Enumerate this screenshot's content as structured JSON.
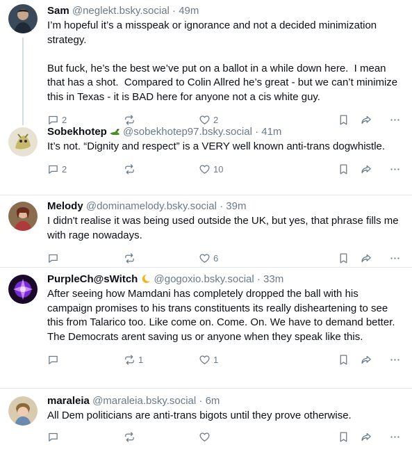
{
  "posts": [
    {
      "name": "Sam",
      "handle": "@neglekt.bsky.social",
      "time": "49m",
      "text": "I’m hopeful it’s a misspeak or ignorance and not a decided minimization strategy.\n\nBut fuck, he’s the best we’ve put on a ballot in a while down here.  I mean that has a shot.  Compared to Colin Allred he’s great - but we can’t minimize this in Texas - it is BAD here for anyone not a cis white guy.",
      "replies": "2",
      "reposts": "",
      "likes": "2"
    },
    {
      "name": "Sobekhotep",
      "handle": "@sobekhotep97.bsky.social",
      "time": "41m",
      "text": "It’s not. “Dignity and respect” is a VERY well known anti-trans dogwhistle.",
      "replies": "2",
      "reposts": "",
      "likes": "10"
    },
    {
      "name": "Melody",
      "handle": "@dominamelody.bsky.social",
      "time": "39m",
      "text": "I didn't realise it was being used outside the UK, but yes, that phrase fills me with rage nowadays.",
      "replies": "",
      "reposts": "",
      "likes": "6"
    },
    {
      "name": "PurpleCh@sWitch",
      "handle": "@gogoxio.bsky.social",
      "time": "33m",
      "text": "After seeing how Mamdani has completely dropped the ball with his campaign promises to his trans constituents its really disheartening to see this from Talarico too. Like come on. Come. On. We have to demand better. The Democrats arent saving us or anyone when they speak like this.",
      "replies": "",
      "reposts": "1",
      "likes": "1"
    },
    {
      "name": "maraleia",
      "handle": "@maraleia.bsky.social",
      "time": "6m",
      "text": "All Dem politicians are anti-trans bigots until they prove otherwise.",
      "replies": "",
      "reposts": "",
      "likes": ""
    }
  ],
  "separator": " · ",
  "icons": [
    "reply-icon",
    "repost-icon",
    "like-icon",
    "bookmark-icon",
    "share-icon",
    "more-icon"
  ]
}
